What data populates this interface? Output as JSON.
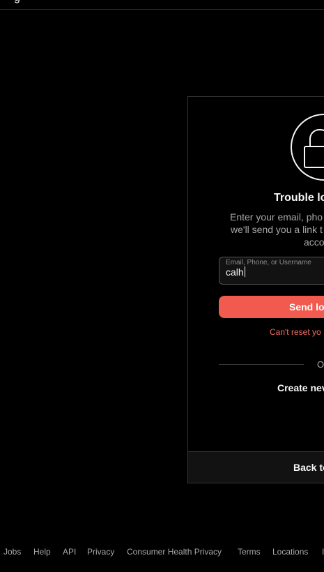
{
  "header": {
    "partial_text": "g"
  },
  "reset_card": {
    "title": "Trouble lo",
    "description_lines": [
      "Enter your email, pho",
      "we'll send you a link t",
      "acco"
    ],
    "input": {
      "label": "Email, Phone, or Username",
      "value": "calh"
    },
    "send_button": "Send lo",
    "cant_reset_link": "Can't reset yo",
    "or_text": "O",
    "create_new_link": "Create nev",
    "back_link": "Back to"
  },
  "footer": {
    "links": [
      "Jobs",
      "Help",
      "API",
      "Privacy",
      "Consumer Health Privacy",
      "Terms",
      "Locations",
      "I"
    ]
  },
  "colors": {
    "background": "#000000",
    "accent": "#f05a4f",
    "link": "#f36c64",
    "muted_text": "#a8a8a8",
    "text": "#f5f5f5"
  }
}
